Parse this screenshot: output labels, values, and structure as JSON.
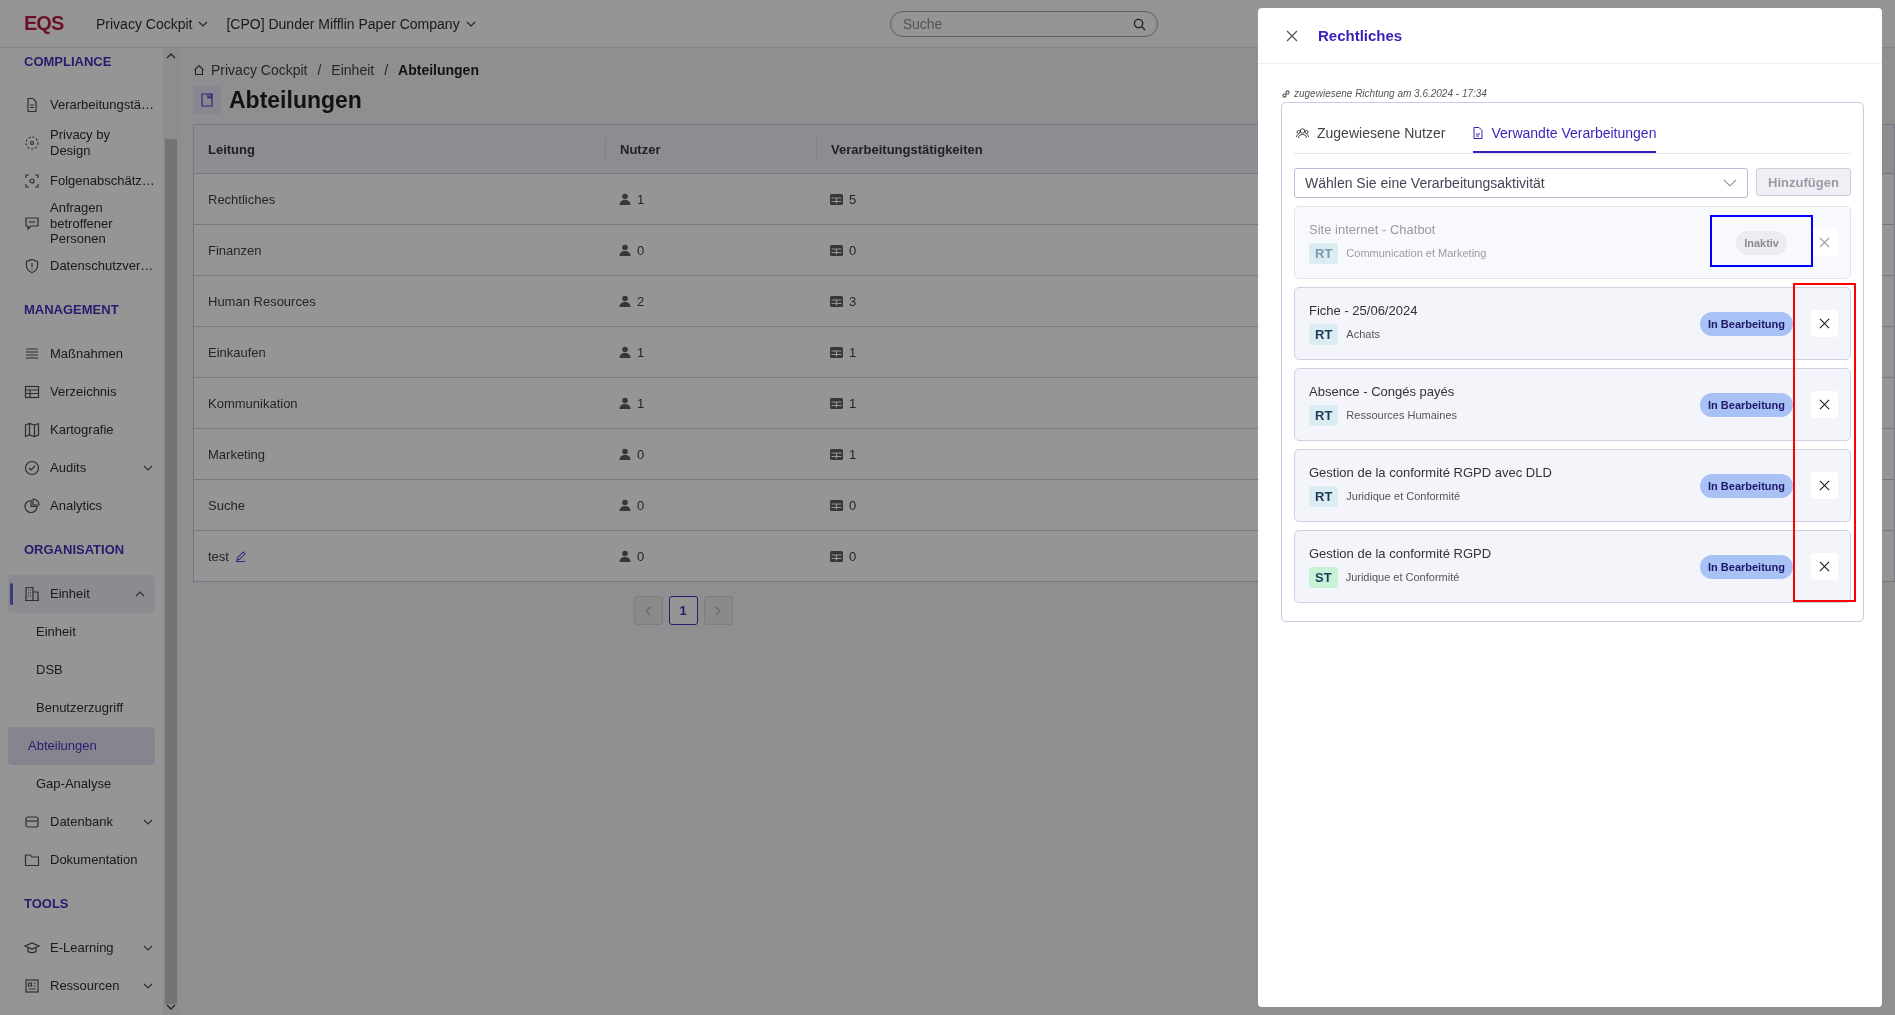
{
  "topbar": {
    "logo": "EQS",
    "product": "Privacy Cockpit",
    "company": "[CPO] Dunder Mifflin Paper Company",
    "search": {
      "placeholder": "Suche"
    }
  },
  "sidebar": {
    "sections": [
      {
        "heading": "COMPLIANCE",
        "items": [
          {
            "label": "Verarbeitungstä…",
            "selected": false
          },
          {
            "label": "Privacy by Design",
            "selected": false
          },
          {
            "label": "Folgenabschätz…",
            "selected": false
          },
          {
            "label": "Anfragen betroffener Personen",
            "selected": false
          },
          {
            "label": "Datenschutzver…",
            "selected": false
          }
        ]
      },
      {
        "heading": "MANAGEMENT",
        "items": [
          {
            "label": "Maßnahmen",
            "selected": false
          },
          {
            "label": "Verzeichnis",
            "selected": false
          },
          {
            "label": "Kartografie",
            "selected": false
          },
          {
            "label": "Audits",
            "selected": false,
            "expanded": false
          },
          {
            "label": "Analytics",
            "selected": false
          }
        ]
      },
      {
        "heading": "ORGANISATION",
        "items": [
          {
            "label": "Einheit",
            "selected": false,
            "expanded": true,
            "children": [
              {
                "label": "Einheit",
                "selected": false
              },
              {
                "label": "DSB",
                "selected": false
              },
              {
                "label": "Benutzerzugriff",
                "selected": false
              },
              {
                "label": "Abteilungen",
                "selected": true
              },
              {
                "label": "Gap-Analyse",
                "selected": false
              }
            ]
          },
          {
            "label": "Datenbank",
            "selected": false,
            "expanded": false
          },
          {
            "label": "Dokumentation",
            "selected": false
          }
        ]
      },
      {
        "heading": "TOOLS",
        "items": [
          {
            "label": "E-Learning",
            "selected": false,
            "expanded": false
          },
          {
            "label": "Ressourcen",
            "selected": false,
            "expanded": false
          }
        ]
      }
    ]
  },
  "breadcrumb": [
    {
      "kind": "link",
      "text": "Privacy Cockpit"
    },
    {
      "kind": "separator",
      "text": "/"
    },
    {
      "kind": "link",
      "text": "Einheit"
    },
    {
      "kind": "separator",
      "text": "/"
    },
    {
      "kind": "current",
      "text": "Abteilungen"
    }
  ],
  "page_title": "Abteilungen",
  "table": {
    "columns": [
      "Leitung",
      "Nutzer",
      "Verarbeitungstätigkeiten"
    ],
    "rows": [
      {
        "name": "Rechtliches",
        "users": "1",
        "activities": "5",
        "editable": false
      },
      {
        "name": "Finanzen",
        "users": "0",
        "activities": "0",
        "editable": false
      },
      {
        "name": "Human Resources",
        "users": "2",
        "activities": "3",
        "editable": false
      },
      {
        "name": "Einkaufen",
        "users": "1",
        "activities": "1",
        "editable": false
      },
      {
        "name": "Kommunikation",
        "users": "1",
        "activities": "1",
        "editable": false
      },
      {
        "name": "Marketing",
        "users": "0",
        "activities": "1",
        "editable": false
      },
      {
        "name": "Suche",
        "users": "0",
        "activities": "0",
        "editable": false
      },
      {
        "name": "test",
        "users": "0",
        "activities": "0",
        "editable": true
      }
    ]
  },
  "pagination": {
    "prev_disabled": true,
    "next_disabled": true,
    "pages": [
      {
        "label": "1",
        "selected": true
      }
    ]
  },
  "drawer": {
    "title": "Rechtliches",
    "meta": "zugewiesene Richtung am 3.6.2024 - 17:34",
    "tabs": [
      {
        "label": "Zugewiesene Nutzer",
        "selected": false
      },
      {
        "label": "Verwandte Verarbeitungen",
        "selected": true
      }
    ],
    "select": {
      "placeholder": "Wählen Sie eine Verarbeitungsaktivität"
    },
    "add_button": {
      "label": "Hinzufügen",
      "disabled": true
    },
    "items": [
      {
        "title": "Site internet - Chatbot",
        "tag": "RT",
        "color": "#dcecf3",
        "department": "Communication et Marketing",
        "status": "Inaktiv",
        "active": false
      },
      {
        "title": "Fiche - 25/06/2024",
        "tag": "RT",
        "color": "#dcecf3",
        "department": "Achats",
        "status": "In Bearbeitung",
        "active": true
      },
      {
        "title": "Absence - Congés payés",
        "tag": "RT",
        "color": "#dcecf3",
        "department": "Ressources Humaines",
        "status": "In Bearbeitung",
        "active": true
      },
      {
        "title": "Gestion de la conformité RGPD avec DLD",
        "tag": "RT",
        "color": "#dcecf3",
        "department": "Juridique et Conformité",
        "status": "In Bearbeitung",
        "active": true
      },
      {
        "title": "Gestion de la conformité RGPD",
        "tag": "ST",
        "color": "#c6f2d8",
        "department": "Juridique et Conformité",
        "status": "In Bearbeitung",
        "active": true
      }
    ],
    "annotations": [
      {
        "kind": "badge_frame",
        "color": "#0000ff"
      },
      {
        "kind": "close_column_frame",
        "color": "#ff0000"
      }
    ]
  }
}
